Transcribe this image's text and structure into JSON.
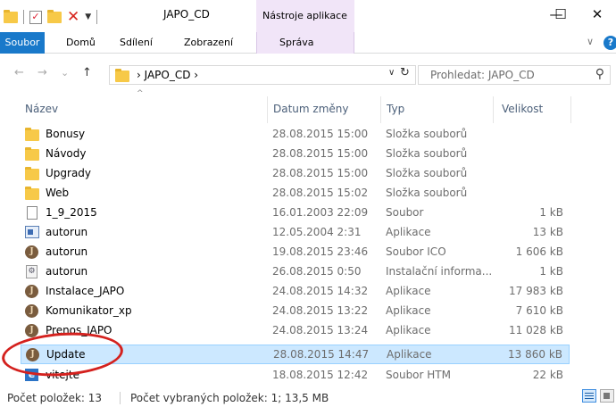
{
  "window": {
    "title": "JAPO_CD",
    "context_group": "Nástroje aplikace",
    "minimize": "—",
    "maximize": "☐",
    "close": "✕"
  },
  "ribbon": {
    "tabs": [
      {
        "label": "Soubor"
      },
      {
        "label": "Domů"
      },
      {
        "label": "Sdílení"
      },
      {
        "label": "Zobrazení"
      },
      {
        "label": "Správa"
      }
    ],
    "expand": "∨",
    "help": "?"
  },
  "navigation": {
    "back": "←",
    "forward": "→",
    "recent": "⌄",
    "up": "↑",
    "address": "›  JAPO_CD  ›",
    "dropdown": "∨",
    "refresh": "↻",
    "search_placeholder": "Prohledat: JAPO_CD",
    "search_icon": "⚲"
  },
  "columns": {
    "sort_indicator": "^",
    "name": "Název",
    "date": "Datum změny",
    "type": "Typ",
    "size": "Velikost"
  },
  "files": [
    {
      "name": "Bonusy",
      "date": "28.08.2015 15:00",
      "type": "Složka souborů",
      "size": "",
      "icon": "folder"
    },
    {
      "name": "Návody",
      "date": "28.08.2015 15:00",
      "type": "Složka souborů",
      "size": "",
      "icon": "folder"
    },
    {
      "name": "Upgrady",
      "date": "28.08.2015 15:00",
      "type": "Složka souborů",
      "size": "",
      "icon": "folder"
    },
    {
      "name": "Web",
      "date": "28.08.2015 15:02",
      "type": "Složka souborů",
      "size": "",
      "icon": "folder"
    },
    {
      "name": "1_9_2015",
      "date": "16.01.2003 22:09",
      "type": "Soubor",
      "size": "1 kB",
      "icon": "file"
    },
    {
      "name": "autorun",
      "date": "12.05.2004 2:31",
      "type": "Aplikace",
      "size": "13 kB",
      "icon": "app"
    },
    {
      "name": "autorun",
      "date": "19.08.2015 23:46",
      "type": "Soubor ICO",
      "size": "1 606 kB",
      "icon": "japo"
    },
    {
      "name": "autorun",
      "date": "26.08.2015 0:50",
      "type": "Instalační informa...",
      "size": "1 kB",
      "icon": "inf"
    },
    {
      "name": "Instalace_JAPO",
      "date": "24.08.2015 14:32",
      "type": "Aplikace",
      "size": "17 983 kB",
      "icon": "japo"
    },
    {
      "name": "Komunikator_xp",
      "date": "24.08.2015 13:22",
      "type": "Aplikace",
      "size": "7 610 kB",
      "icon": "japo"
    },
    {
      "name": "Prenos_JAPO",
      "date": "24.08.2015 13:24",
      "type": "Aplikace",
      "size": "11 028 kB",
      "icon": "japo"
    },
    {
      "name": "Update",
      "date": "28.08.2015 14:47",
      "type": "Aplikace",
      "size": "13 860 kB",
      "icon": "japo",
      "selected": true
    },
    {
      "name": "vitejte",
      "date": "18.08.2015 12:42",
      "type": "Soubor HTM",
      "size": "22 kB",
      "icon": "htm"
    }
  ],
  "icon_glyphs": {
    "japo": "J",
    "inf": "⚙",
    "htm": "e"
  },
  "status": {
    "count": "Počet položek: 13",
    "selected": "Počet vybraných položek: 1; 13,5 MB"
  },
  "colors": {
    "accent": "#1979ca",
    "context_tab": "#f1e5f8",
    "selection": "#cce8ff",
    "highlight_circle": "#d4211e"
  }
}
